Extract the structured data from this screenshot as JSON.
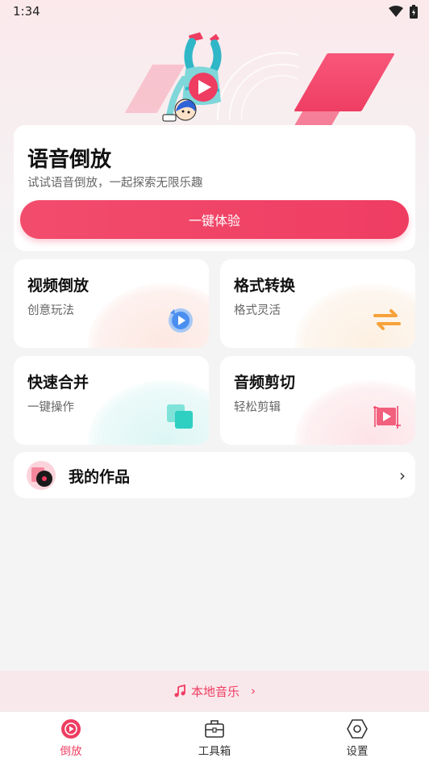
{
  "status_bar": {
    "time": "1:34"
  },
  "hero": {
    "title": "语音倒放",
    "subtitle": "试试语音倒放，一起探索无限乐趣",
    "button_label": "一键体验"
  },
  "features": [
    {
      "title": "视频倒放",
      "subtitle": "创意玩法",
      "icon": "replay-icon"
    },
    {
      "title": "格式转换",
      "subtitle": "格式灵活",
      "icon": "swap-arrows-icon"
    },
    {
      "title": "快速合并",
      "subtitle": "一键操作",
      "icon": "merge-squares-icon"
    },
    {
      "title": "音频剪切",
      "subtitle": "轻松剪辑",
      "icon": "cut-play-icon"
    }
  ],
  "works": {
    "label": "我的作品"
  },
  "local_music": {
    "label": "本地音乐"
  },
  "tabs": [
    {
      "label": "倒放",
      "icon": "play-circle-icon",
      "active": true
    },
    {
      "label": "工具箱",
      "icon": "toolbox-icon",
      "active": false
    },
    {
      "label": "设置",
      "icon": "settings-hexagon-icon",
      "active": false
    }
  ],
  "colors": {
    "accent": "#ef3d62",
    "background": "#f4f4f5",
    "local_bar_bg": "#f9e8eb"
  }
}
